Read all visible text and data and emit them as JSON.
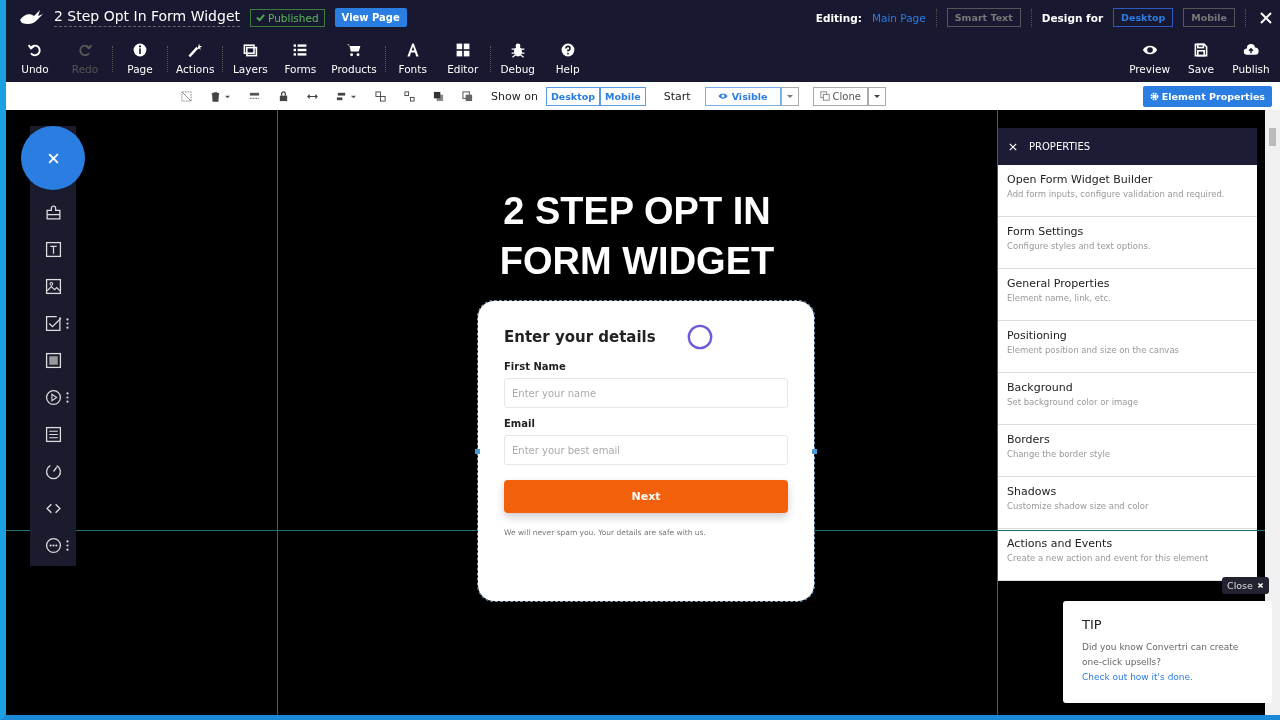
{
  "header": {
    "title": "2 Step Opt In Form Widget",
    "status": "Published",
    "view_button": "View Page",
    "editing_label": "Editing:",
    "editing_page": "Main Page",
    "smart_text": "Smart Text",
    "design_for_label": "Design for",
    "devices": [
      {
        "label": "Desktop",
        "selected": true
      },
      {
        "label": "Mobile",
        "selected": false
      }
    ]
  },
  "toolbar": {
    "left": [
      {
        "label": "Undo",
        "disabled": false
      },
      {
        "label": "Redo",
        "disabled": true
      },
      {
        "label": "Page",
        "disabled": false
      },
      {
        "label": "Actions",
        "disabled": false
      },
      {
        "label": "Layers",
        "disabled": false
      },
      {
        "label": "Forms",
        "disabled": false
      },
      {
        "label": "Products",
        "disabled": false
      },
      {
        "label": "Fonts",
        "disabled": false
      },
      {
        "label": "Editor",
        "disabled": false
      },
      {
        "label": "Debug",
        "disabled": false
      },
      {
        "label": "Help",
        "disabled": false
      }
    ],
    "right": [
      {
        "label": "Preview"
      },
      {
        "label": "Save"
      },
      {
        "label": "Publish"
      }
    ]
  },
  "edit_bar": {
    "show_on_label": "Show on",
    "show_on": [
      {
        "label": "Desktop",
        "selected": true
      },
      {
        "label": "Mobile",
        "selected": true
      }
    ],
    "start_label": "Start",
    "start_value": "Visible",
    "clone": "Clone",
    "properties_button": "Element Properties"
  },
  "canvas": {
    "heading": "2 STEP OPT IN FORM WIDGET",
    "form": {
      "title": "Enter your details",
      "fields": [
        {
          "label": "First Name",
          "placeholder": "Enter your name"
        },
        {
          "label": "Email",
          "placeholder": "Enter your best email"
        }
      ],
      "button": "Next",
      "note": "We will never spam you. Your details are safe with us."
    }
  },
  "properties": {
    "title": "PROPERTIES",
    "items": [
      {
        "title": "Open Form Widget Builder",
        "description": "Add form inputs, configure validation and required."
      },
      {
        "title": "Form Settings",
        "description": "Configure styles and text options."
      },
      {
        "title": "General Properties",
        "description": "Element name, link, etc."
      },
      {
        "title": "Positioning",
        "description": "Element position and size on the canvas"
      },
      {
        "title": "Background",
        "description": "Set background color or image"
      },
      {
        "title": "Borders",
        "description": "Change the border style"
      },
      {
        "title": "Shadows",
        "description": "Customize shadow size and color"
      },
      {
        "title": "Actions and Events",
        "description": "Create a new action and event for this element"
      }
    ]
  },
  "close_button": "Close",
  "tip": {
    "title": "TIP",
    "text": "Did you know Convertri can create one-click upsells?",
    "link": "Check out how it's done."
  }
}
